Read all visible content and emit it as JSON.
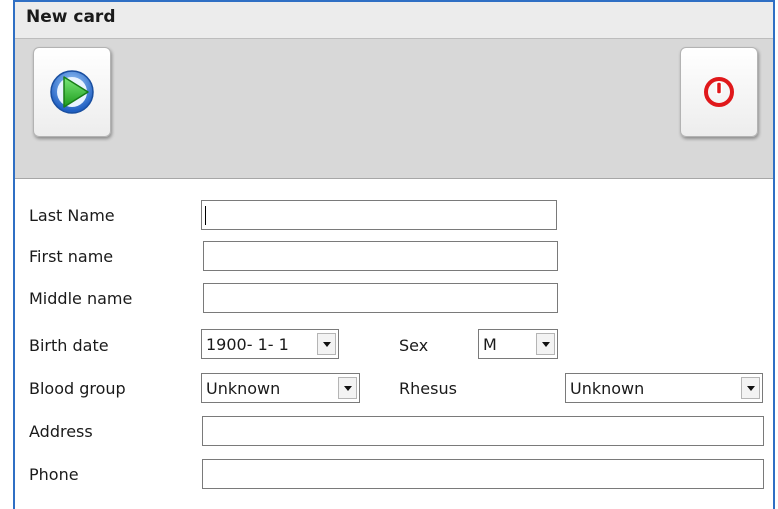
{
  "window": {
    "title": "New card"
  },
  "toolbar": {
    "next_icon": "play-icon",
    "exit_icon": "power-icon"
  },
  "form": {
    "last_name_label": "Last Name",
    "last_name_value": "",
    "first_name_label": "First name",
    "first_name_value": "",
    "middle_name_label": "Middle name",
    "middle_name_value": "",
    "birth_date_label": "Birth date",
    "birth_date_value": "1900- 1- 1",
    "sex_label": "Sex",
    "sex_value": "M",
    "blood_group_label": "Blood group",
    "blood_group_value": "Unknown",
    "rhesus_label": "Rhesus",
    "rhesus_value": "Unknown",
    "address_label": "Address",
    "address_value": "",
    "phone_label": "Phone",
    "phone_value": ""
  },
  "colors": {
    "window_border": "#2f6fc4",
    "play_green": "#2fb52f",
    "play_ring": "#2f78d6",
    "power_red": "#e0181b"
  }
}
